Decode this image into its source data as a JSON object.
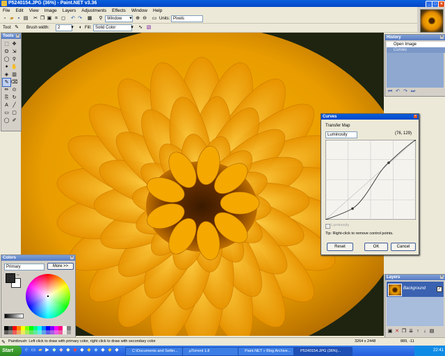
{
  "window": {
    "title": "P5240154.JPG (36%) - Paint.NET v3.36"
  },
  "menu": [
    "File",
    "Edit",
    "View",
    "Image",
    "Layers",
    "Adjustments",
    "Effects",
    "Window",
    "Help"
  ],
  "toolbar1": {
    "zoom_label": "Window",
    "units_label": "Units:",
    "units_value": "Pixels"
  },
  "toolbar2": {
    "tool_label": "Tool:",
    "brush_width_label": "Brush width:",
    "brush_width_value": "2",
    "fill_label": "Fill:",
    "fill_value": "Solid Color"
  },
  "tools_panel": {
    "title": "Tools",
    "icons": [
      "select-rect-icon",
      "move-icon",
      "lasso-icon",
      "move-selection-icon",
      "ellipse-select-icon",
      "zoom-icon",
      "magic-wand-icon",
      "pan-icon",
      "paint-bucket-icon",
      "gradient-icon",
      "paintbrush-icon",
      "eraser-icon",
      "pencil-icon",
      "color-picker-icon",
      "clone-stamp-icon",
      "recolor-icon",
      "text-icon",
      "line-icon",
      "rectangle-icon",
      "rounded-rect-icon",
      "ellipse-icon",
      "freeform-icon"
    ]
  },
  "history": {
    "title": "History",
    "items": [
      "Open Image",
      "Curves"
    ]
  },
  "colors": {
    "title": "Colors",
    "mode": "Primary",
    "more_button": "More >>",
    "primary": "#2b2b2b",
    "secondary": "#ffffff"
  },
  "layers": {
    "title": "Layers",
    "items": [
      "Background"
    ]
  },
  "curves": {
    "title": "Curves",
    "transfer_map_label": "Transfer Map",
    "mode": "Luminosity",
    "coords": "(76, 129)",
    "luminosity_checkbox": "Luminosity",
    "tip": "Tip: Right-click to remove control points.",
    "reset": "Reset",
    "ok": "OK",
    "cancel": "Cancel"
  },
  "status": {
    "text": "Paintbrush: Left click to draw with primary color, right click to draw with secondary color",
    "size": "3264 x 2448",
    "pos": "889, -11"
  },
  "taskbar": {
    "start": "Start",
    "tasks": [
      "C:\\Documents and Settin...",
      "µTorrent 1.8",
      "Paint.NET » Blog Archive...",
      "P5240154.JPG (36%)..."
    ],
    "clock": "22:41"
  }
}
